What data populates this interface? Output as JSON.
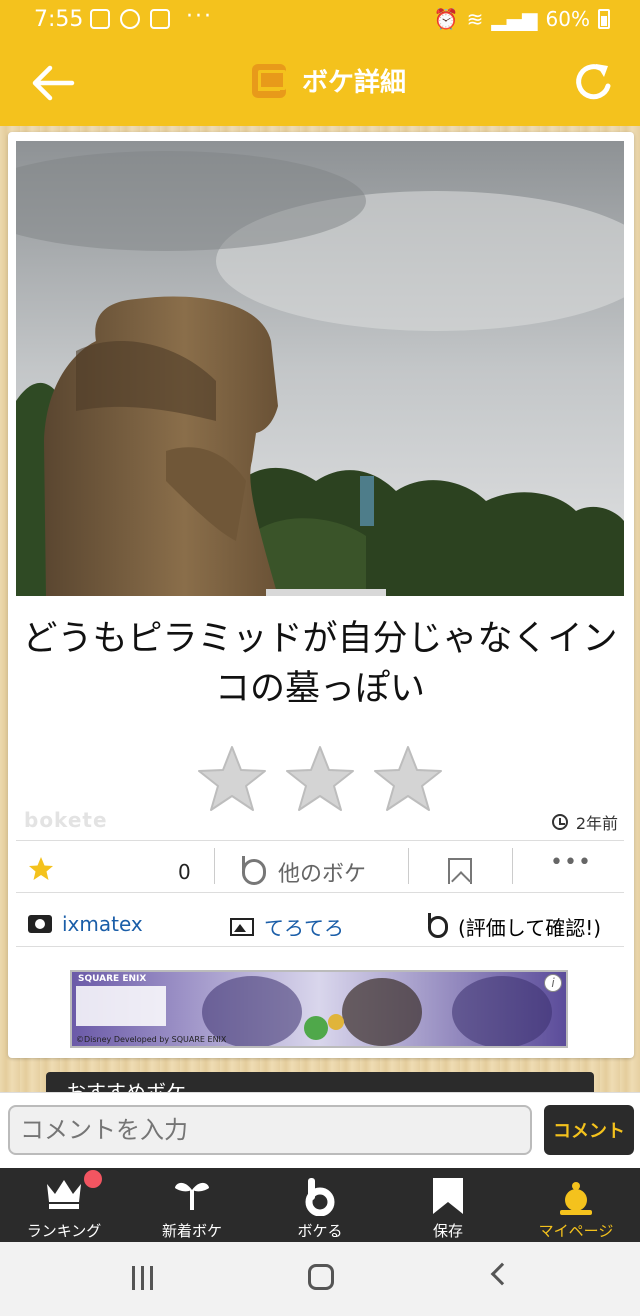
{
  "status_bar": {
    "time": "7:55",
    "battery": "60%",
    "more": "···"
  },
  "header": {
    "title": "ボケ詳細",
    "icons": {
      "back": "arrow-left-icon",
      "reload": "refresh-icon",
      "title": "screen-icon"
    }
  },
  "post": {
    "caption": "どうもピラミッドが自分じゃなくインコの墓っぽい",
    "rating_stars": 3,
    "rating_filled": 0,
    "watermark": "bokete",
    "posted_ago": "2年前",
    "favorites_count": "0",
    "other_boke_label": "他のボケ",
    "photographer": "ixmatex",
    "title_author": "てろてろ",
    "evaluate_hint": "(評価して確認!)"
  },
  "banner": {
    "brand": "SQUARE ENIX",
    "credit": "©Disney Developed by SQUARE ENIX",
    "info": "i"
  },
  "recommended": {
    "label": "おすすめボケ"
  },
  "comment": {
    "placeholder": "コメントを入力",
    "button": "コメント"
  },
  "tabs": [
    {
      "label": "ランキング",
      "icon": "crown-icon",
      "active": false,
      "badge": true
    },
    {
      "label": "新着ボケ",
      "icon": "sprout-icon",
      "active": false
    },
    {
      "label": "ボケる",
      "icon": "bokete-b-icon",
      "active": false
    },
    {
      "label": "保存",
      "icon": "bookmark-icon",
      "active": false
    },
    {
      "label": "マイページ",
      "icon": "user-icon",
      "active": true
    }
  ],
  "colors": {
    "accent": "#f4c21d",
    "tabbar": "#2b2b2b",
    "link": "#1b5ea8",
    "star_favorite": "#f4c21d",
    "badge": "#f25561"
  }
}
